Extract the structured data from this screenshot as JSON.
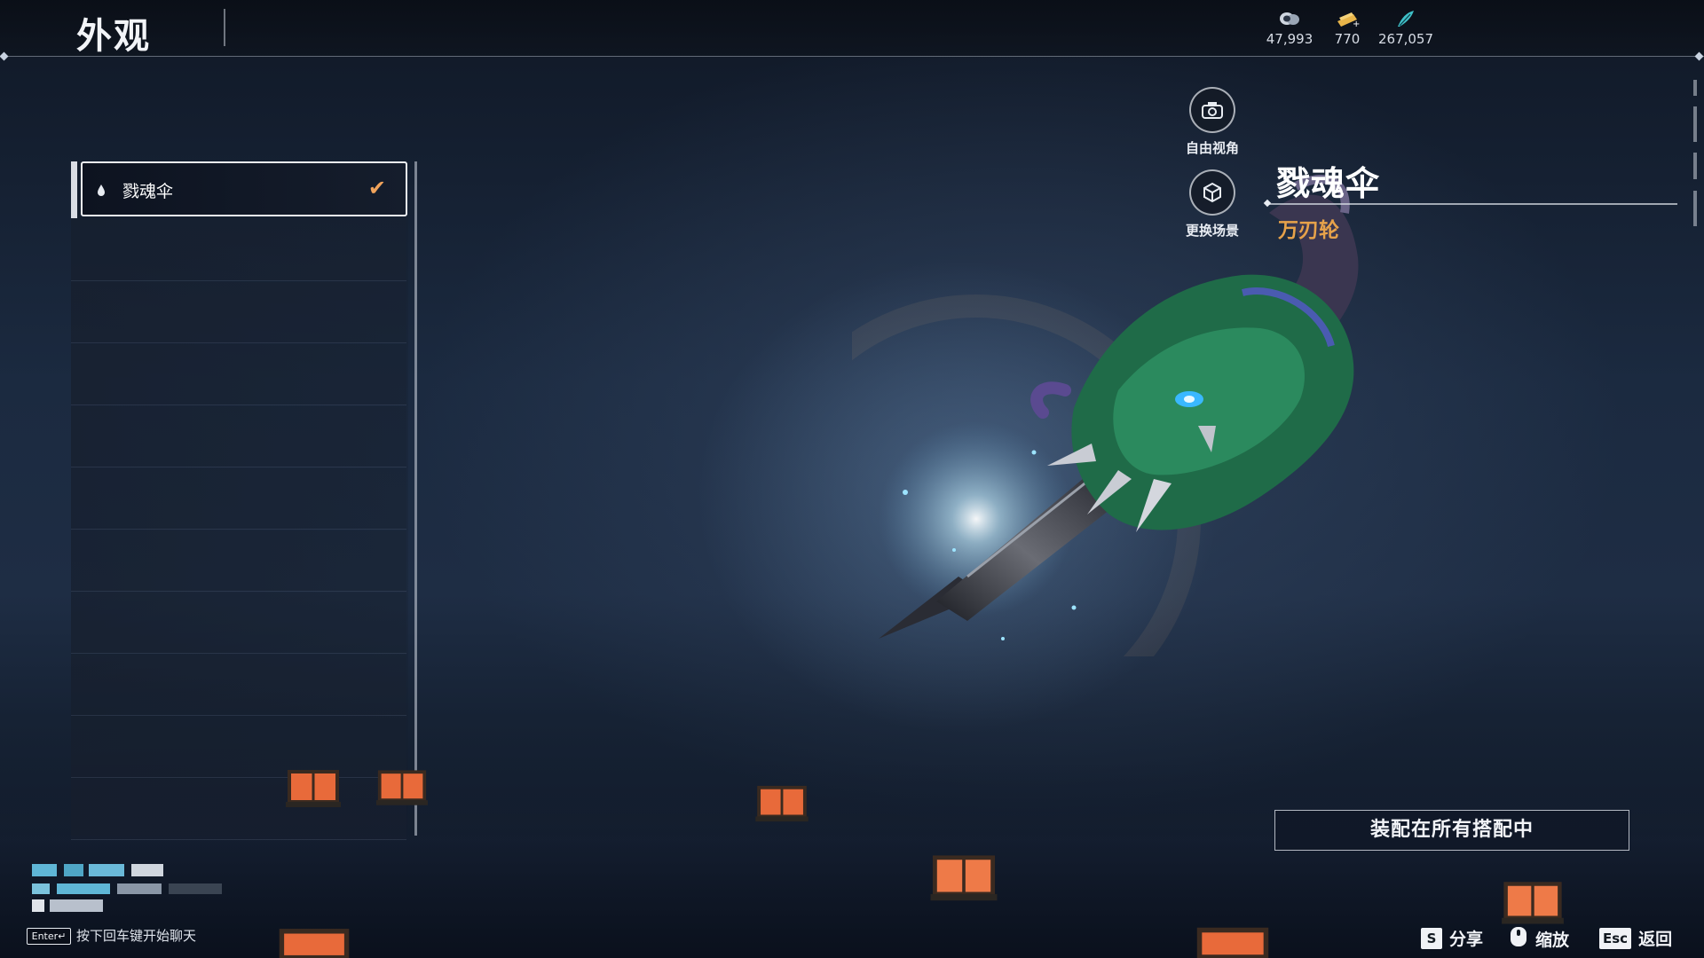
{
  "header": {
    "title": "外观",
    "currencies": [
      {
        "icon": "coin-stack-icon",
        "value": "47,993"
      },
      {
        "icon": "gold-ticket-icon",
        "value": "770"
      },
      {
        "icon": "feather-token-icon",
        "value": "267,057"
      }
    ]
  },
  "list": {
    "items": [
      {
        "label": "戮魂伞",
        "selected": true,
        "icon": "drop-icon"
      }
    ]
  },
  "side_buttons": {
    "free_camera": "自由视角",
    "change_scene": "更换场景"
  },
  "item": {
    "name": "戮魂伞",
    "type": "万刃轮"
  },
  "equip_button": "装配在所有搭配中",
  "chat": {
    "enter_key": "Enter↵",
    "hint": "按下回车键开始聊天"
  },
  "hotkeys": [
    {
      "key": "S",
      "label": "分享"
    },
    {
      "key": "",
      "label": "缩放",
      "icon": "mouse-icon"
    },
    {
      "key": "Esc",
      "label": "返回"
    }
  ],
  "colors": {
    "accent_orange": "#e7a24a",
    "check_orange": "#f1a35b"
  }
}
